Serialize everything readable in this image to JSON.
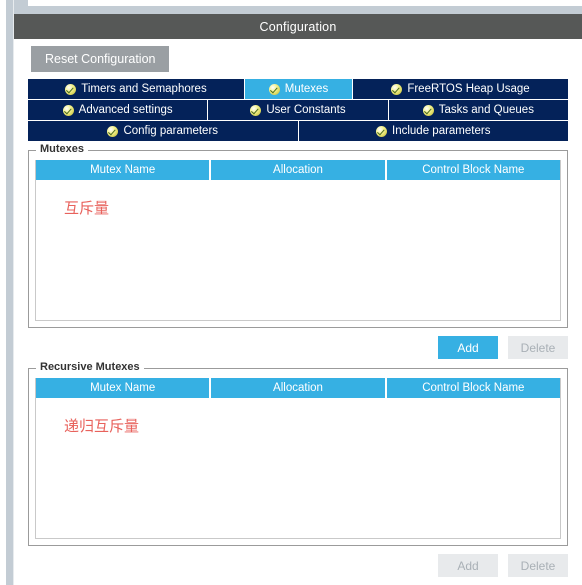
{
  "window": {
    "title": "Configuration"
  },
  "toolbar": {
    "reset_label": "Reset Configuration"
  },
  "tabs": {
    "rows": [
      [
        {
          "label": "Timers and Semaphores",
          "icon": "check-circle-icon",
          "active": false,
          "flex": 228
        },
        {
          "label": "Mutexes",
          "icon": "check-circle-icon",
          "active": true,
          "flex": 113
        },
        {
          "label": "FreeRTOS Heap Usage",
          "icon": "check-circle-icon",
          "active": false,
          "flex": 227
        }
      ],
      [
        {
          "label": "Advanced settings",
          "icon": "check-circle-icon",
          "active": false,
          "flex": 180
        },
        {
          "label": "User Constants",
          "icon": "check-circle-icon",
          "active": false,
          "flex": 180
        },
        {
          "label": "Tasks and Queues",
          "icon": "check-circle-icon",
          "active": false,
          "flex": 180
        }
      ],
      [
        {
          "label": "Config parameters",
          "icon": "check-circle-icon",
          "active": false,
          "flex": 270
        },
        {
          "label": "Include parameters",
          "icon": "check-circle-icon",
          "active": false,
          "flex": 270
        }
      ]
    ]
  },
  "groups": [
    {
      "legend": "Mutexes",
      "columns": [
        "Mutex Name",
        "Allocation",
        "Control Block Name"
      ],
      "rows": [],
      "annotation": "互斥量",
      "body_height": 140,
      "buttons": [
        {
          "label": "Add",
          "state": "enabled"
        },
        {
          "label": "Delete",
          "state": "disabled"
        }
      ]
    },
    {
      "legend": "Recursive Mutexes",
      "columns": [
        "Mutex Name",
        "Allocation",
        "Control Block Name"
      ],
      "rows": [],
      "annotation": "递归互斥量",
      "body_height": 140,
      "buttons": [
        {
          "label": "Add",
          "state": "disabled"
        },
        {
          "label": "Delete",
          "state": "disabled"
        }
      ]
    }
  ],
  "colors": {
    "titlebar_bg": "#565857",
    "tab_bg": "#042259",
    "tab_active_bg": "#36b0e3",
    "table_header_bg": "#36b0e3",
    "primary_button_bg": "#36b0e3",
    "disabled_button_bg": "#e8eaec",
    "annotation_red": "#e8625c",
    "reset_button_bg": "#9a9fa3",
    "chrome_bg": "#c3ccd4"
  }
}
